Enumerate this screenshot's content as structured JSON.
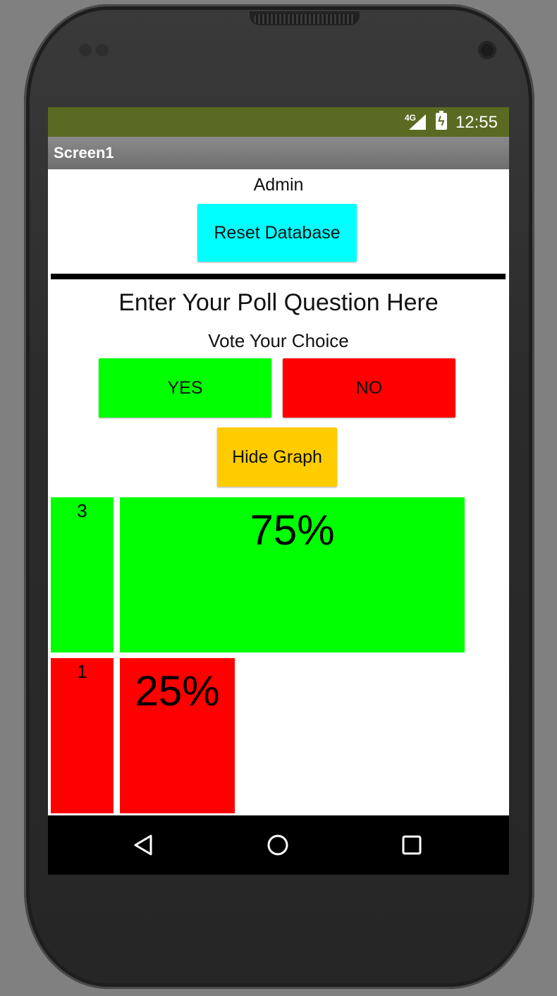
{
  "status_bar": {
    "network": "4G",
    "time": "12:55",
    "signal_icon": "signal-icon",
    "battery_icon": "battery-charging-icon"
  },
  "app": {
    "title": "Screen1"
  },
  "admin": {
    "label": "Admin",
    "reset_button": "Reset Database"
  },
  "poll": {
    "question": "Enter Your Poll Question Here",
    "vote_label": "Vote Your Choice",
    "yes_button": "YES",
    "no_button": "NO",
    "hide_graph_button": "Hide Graph"
  },
  "results": {
    "yes": {
      "count": "3",
      "percent_label": "75%",
      "fraction": 0.75,
      "color": "#00ff00"
    },
    "no": {
      "count": "1",
      "percent_label": "25%",
      "fraction": 0.25,
      "color": "#ff0000"
    }
  },
  "nav": {
    "back_icon": "back-triangle-icon",
    "home_icon": "home-circle-icon",
    "recents_icon": "recents-square-icon"
  },
  "colors": {
    "status_bar": "#5a6a22",
    "reset_button": "#00ffff",
    "yes": "#00ff00",
    "no": "#ff0000",
    "hide_graph": "#ffcc00"
  }
}
